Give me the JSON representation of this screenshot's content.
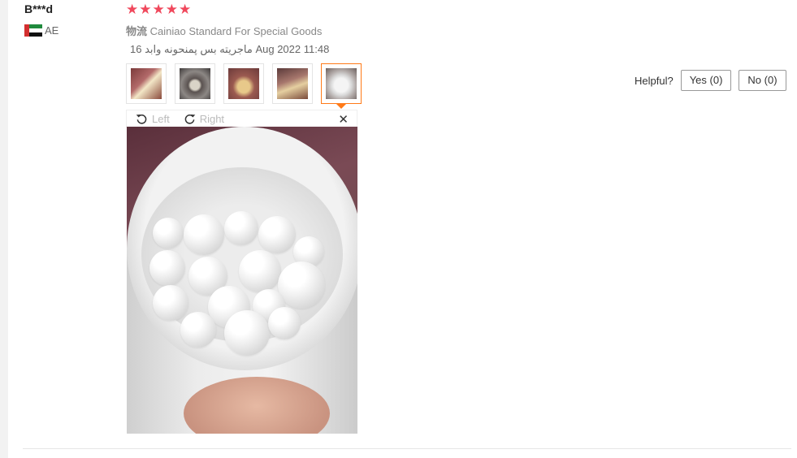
{
  "review": {
    "user_name": "B***d",
    "country_code": "AE",
    "rating": 5,
    "shipping_cn": "物流",
    "shipping_text": "Cainiao Standard For Special Goods",
    "date": "16 ماجريته بس پمنحونه وابد Aug 2022 11:48"
  },
  "thumbnails": [
    {
      "name": "photo-1",
      "active": false
    },
    {
      "name": "photo-2",
      "active": false
    },
    {
      "name": "photo-3",
      "active": false
    },
    {
      "name": "photo-4",
      "active": false
    },
    {
      "name": "photo-5",
      "active": true
    }
  ],
  "helpful": {
    "label": "Helpful?",
    "yes_label": "Yes (0)",
    "no_label": "No (0)"
  },
  "viewer": {
    "rotate_left_label": "Left",
    "rotate_right_label": "Right",
    "close_label": "✕"
  },
  "icons": {
    "star": "★",
    "rotate_left": "rotate-left-icon",
    "rotate_right": "rotate-right-icon"
  },
  "colors": {
    "star": "#f0485c",
    "active_thumb_border": "#ff7a18"
  }
}
